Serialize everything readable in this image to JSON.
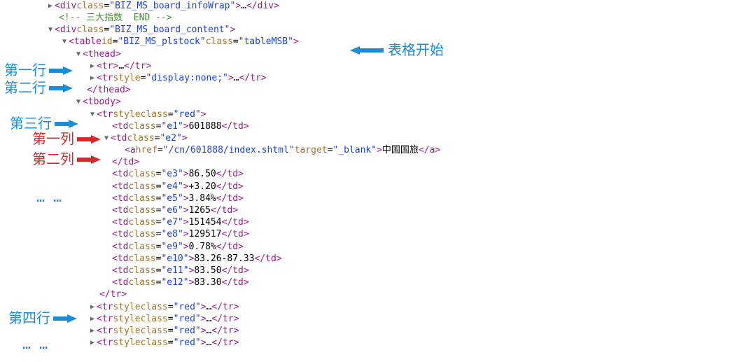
{
  "annotations": {
    "table_start": "表格开始",
    "row1": "第一行",
    "row2": "第二行",
    "row3": "第三行",
    "row4": "第四行",
    "col1": "第一列",
    "col2": "第二列",
    "dots1": "…  …",
    "dots2": "…  …"
  },
  "code": {
    "div_infowrap_class": "BIZ_MS_board_infoWrap",
    "comment_end": " 三大指数  END ",
    "div_content_class": "BIZ_MS_board_content",
    "table_id": "BIZ_MS_plstock",
    "table_class": "tableMSB",
    "thead": "thead",
    "tr": "tr",
    "tr2_style": "display:none;",
    "tbody": "tbody",
    "tr3_class": "red",
    "td_e1": "e1",
    "td_e1_val": "601888",
    "td_e2": "e2",
    "a_href": "/cn/601888/index.shtml",
    "a_target": "_blank",
    "a_text": "中国国旅",
    "td_e3": "e3",
    "td_e3_val": "86.50",
    "td_e4": "e4",
    "td_e4_val": "+3.20",
    "td_e5": "e5",
    "td_e5_val": "3.84%",
    "td_e6": "e6",
    "td_e6_val": "1265",
    "td_e7": "e7",
    "td_e7_val": "151454",
    "td_e8": "e8",
    "td_e8_val": "129517",
    "td_e9": "e9",
    "td_e9_val": "0.78%",
    "td_e10": "e10",
    "td_e10_val": "83.26-87.33",
    "td_e11": "e11",
    "td_e11_val": "83.50",
    "td_e12": "e12",
    "td_e12_val": "83.30",
    "style_attr": "style",
    "class_attr": "class",
    "red_val": "red"
  }
}
